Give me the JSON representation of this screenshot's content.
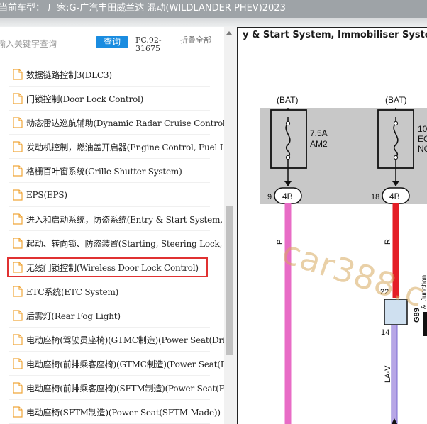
{
  "window": {
    "title": "当前车型： 厂家:G-广汽丰田威兰达 混动(WILDLANDER PHEV)2023"
  },
  "toolbar": {
    "search_placeholder": "输入关键字查询",
    "search_button": "查询",
    "code": "PC.92-31675",
    "collapse_all": "折叠全部"
  },
  "tree": {
    "items": [
      {
        "label": "数据链路控制3(DLC3)"
      },
      {
        "label": "门锁控制(Door Lock Control)"
      },
      {
        "label": "动态雷达巡航辅助(Dynamic Radar Cruise Control)"
      },
      {
        "label": "发动机控制，燃油盖开启器(Engine Control, Fuel Lid Opener)"
      },
      {
        "label": "格栅百叶窗系统(Grille Shutter System)"
      },
      {
        "label": "EPS(EPS)"
      },
      {
        "label": "进入和启动系统，防盗系统(Entry & Start System, Immobiliser System)"
      },
      {
        "label": "起动、转向锁、防盗装置(Starting, Steering Lock, Immobiliser)"
      },
      {
        "label": "无线门锁控制(Wireless Door Lock Control)",
        "selected": true
      },
      {
        "label": "ETC系统(ETC System)"
      },
      {
        "label": "后雾灯(Rear Fog Light)"
      },
      {
        "label": "电动座椅(驾驶员座椅)(GTMC制造)(Power Seat(Driver's Seat)(GTMC Made))"
      },
      {
        "label": "电动座椅(前排乘客座椅)(GTMC制造)(Power Seat(Front Passenger's Seat)(GTMC Made))"
      },
      {
        "label": "电动座椅(前排乘客座椅)(SFTM制造)(Power Seat(Front Passenger's Seat)(SFTM Made))"
      },
      {
        "label": "电动座椅(SFTM制造)(Power Seat(SFTM Made))"
      }
    ]
  },
  "diagram": {
    "title": "y & Start System, Immobiliser System",
    "bat_left": "(BAT)",
    "bat_right": "(BAT)",
    "fuse_amp": "7.5A",
    "fuse_name": "AM2",
    "fuse_right_1": "10",
    "fuse_right_2": "EC",
    "fuse_right_3": "NC",
    "conn_left_pin": "9",
    "conn_left": "4B",
    "conn_right_pin": "18",
    "conn_right": "4B",
    "wire_left_color": "P",
    "wire_right_color": "R",
    "jc_pin_top": "22",
    "jc_pin_bottom": "14",
    "jc_name": "G89",
    "jc_label": "Junction",
    "jc_sub": "&",
    "wire_lower": "LA-V",
    "watermark": "car388.c"
  },
  "colors": {
    "titlebar": "#9ea3a7",
    "search_button": "#1a8ce0",
    "selection_border": "#e03131",
    "wire_pink": "#e86cc6",
    "wire_red": "#e41e26",
    "wire_lavender": "#b7a6e6"
  }
}
